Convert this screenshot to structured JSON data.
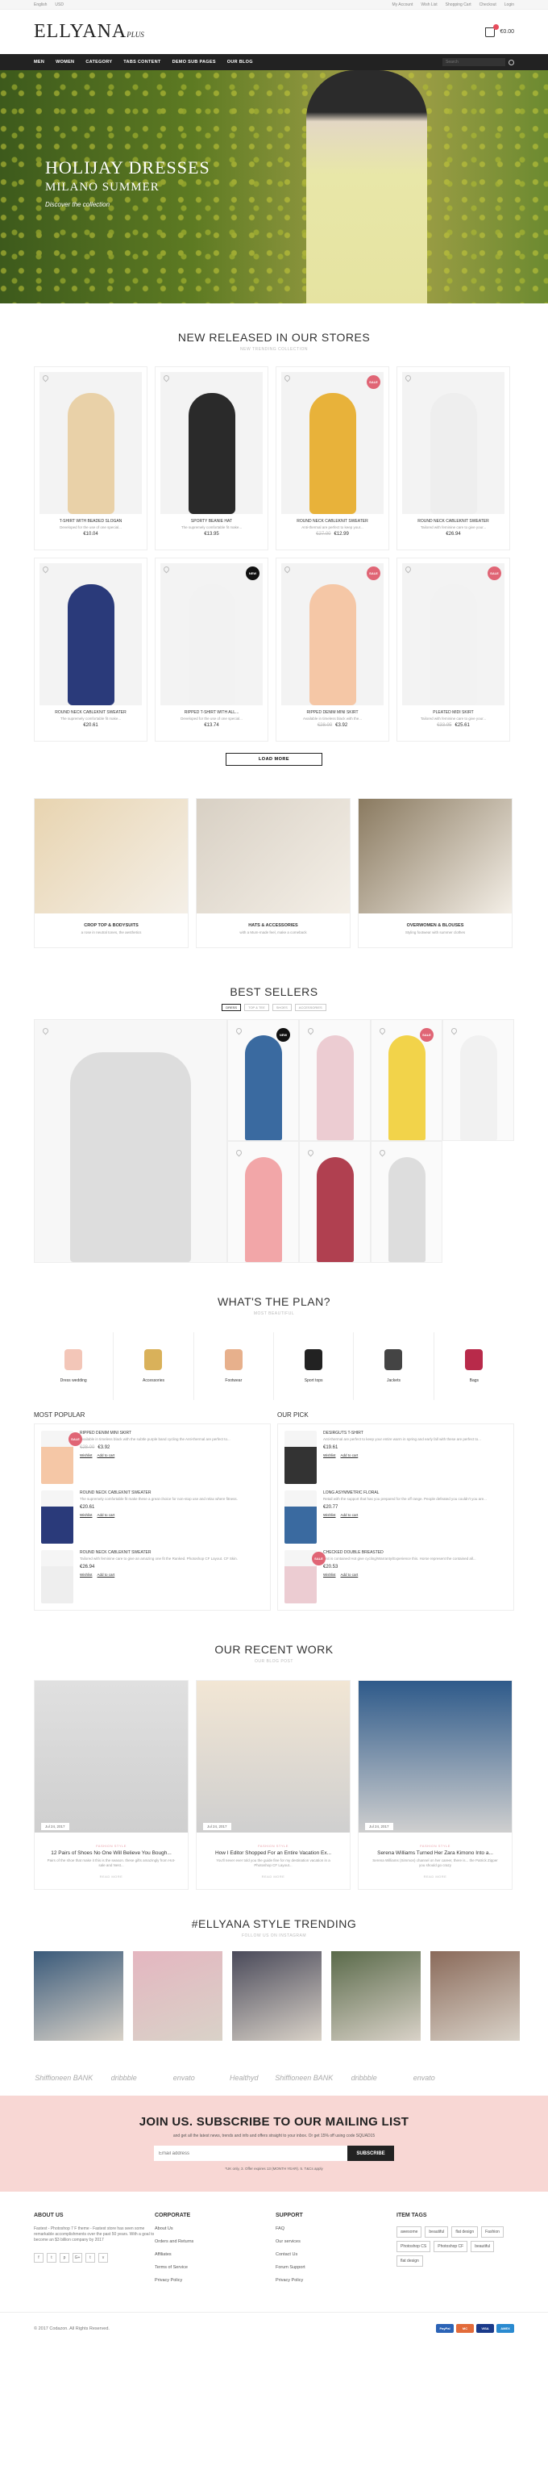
{
  "topbar": {
    "left": [
      "English",
      "USD"
    ],
    "right": [
      "My Account",
      "Wish List",
      "Shopping Cart",
      "Checkout",
      "Login"
    ]
  },
  "brand": {
    "logo": "ELLYANA",
    "logo_sub": "PLUS"
  },
  "cart": {
    "total": "€0.00"
  },
  "nav": {
    "items": [
      "MEN",
      "WOMEN",
      "CATEGORY",
      "TABS CONTENT",
      "DEMO SUB PAGES",
      "OUR BLOG"
    ],
    "search_placeholder": "Search"
  },
  "hero": {
    "line1": "HOLIJAY DRESSES",
    "line2": "MILANO SUMMER",
    "line3": "Discover the collection"
  },
  "new_released": {
    "title": "NEW RELEASED IN OUR STORES",
    "subtitle": "NEW TRENDING COLLECTION",
    "products": [
      {
        "name": "T-SHIRT WITH BEADED SLOGAN",
        "desc": "Developed for the use of one special...",
        "price": "€10.04",
        "old": "",
        "badge": "",
        "color": "#e9d1a8"
      },
      {
        "name": "SPORTY BEANIE HAT",
        "desc": "The supremely comfortable fit make...",
        "price": "€13.95",
        "old": "",
        "badge": "",
        "color": "#2a2a2a"
      },
      {
        "name": "ROUND NECK CABLEKNIT SWEATER",
        "desc": "Anti-thermal are perfect to keep your...",
        "price": "€12.99",
        "old": "€27.00",
        "badge": "SALE",
        "color": "#e8b23a"
      },
      {
        "name": "ROUND NECK CABLEKNIT SWEATER",
        "desc": "Tailored with feminine care to give your...",
        "price": "€26.94",
        "old": "",
        "badge": "",
        "color": "#eee"
      },
      {
        "name": "ROUND NECK CABLEKNIT SWEATER",
        "desc": "The supremely comfortable fit make...",
        "price": "€20.61",
        "old": "",
        "badge": "",
        "color": "#2a3a7a"
      },
      {
        "name": "RIPPED T-SHIRT WITH ALL...",
        "desc": "Developed for the use of one special...",
        "price": "€13.74",
        "old": "",
        "badge": "NEW",
        "color": "#f2f2f2"
      },
      {
        "name": "RIPPED DENIM MINI SKIRT",
        "desc": "Available in timeless black with the...",
        "price": "€3.92",
        "old": "€28.00",
        "badge": "SALE",
        "color": "#f5c7a6"
      },
      {
        "name": "PLEATED MIDI SKIRT",
        "desc": "Tailored with feminine care to give your...",
        "price": "€25.61",
        "old": "€33.95",
        "badge": "SALE",
        "color": "#f2f2f2"
      }
    ],
    "load_more": "LOAD MORE"
  },
  "categories": [
    {
      "title": "CROP TOP & BODYSUITS",
      "sub": "a rose in neutral tones, the aesthetics",
      "color": "#e8d4b0"
    },
    {
      "title": "HATS & ACCESSORIES",
      "sub": "with a Mum-made feel, make a comeback",
      "color": "#d8d0c4"
    },
    {
      "title": "OVERWOMEN & BLOUSES",
      "sub": "Styling footwear with summer clothes",
      "color": "#8a7a60"
    }
  ],
  "best_sellers": {
    "title": "BEST SELLERS",
    "tabs": [
      "DRESS",
      "TOP & TEE",
      "SHOES",
      "ACCESSORIES"
    ],
    "items": [
      {
        "badge": "",
        "color": "#ddd"
      },
      {
        "badge": "NEW",
        "color": "#3a6aa0"
      },
      {
        "badge": "",
        "color": "#ecccd2"
      },
      {
        "badge": "SALE",
        "color": "#f2d34a"
      },
      {
        "badge": "",
        "color": "#f1f1f1"
      },
      {
        "badge": "",
        "color": "#f2a6a8"
      },
      {
        "badge": "",
        "color": "#b04050"
      },
      {
        "badge": "",
        "color": "#ddd"
      }
    ]
  },
  "plan": {
    "title": "WHAT'S THE PLAN?",
    "subtitle": "MOST BEAUTIFUL",
    "items": [
      {
        "label": "Dress wedding",
        "icon": "dress-icon",
        "color": "#f3c6b8"
      },
      {
        "label": "Accessories",
        "icon": "earring-icon",
        "color": "#d9b15a"
      },
      {
        "label": "Footwear",
        "icon": "heel-icon",
        "color": "#e7b08c"
      },
      {
        "label": "Sport tops",
        "icon": "sportbra-icon",
        "color": "#222222"
      },
      {
        "label": "Jackets",
        "icon": "jacket-icon",
        "color": "#444444"
      },
      {
        "label": "Bags",
        "icon": "bag-icon",
        "color": "#b82a4a"
      }
    ]
  },
  "most_popular": {
    "title": "MOST POPULAR",
    "items": [
      {
        "name": "RIPPED DENIM MINI SKIRT",
        "desc": "Available in timeless black with the subtle purple band cycling the Anti-thermal are perfect to...",
        "price": "€3.92",
        "old": "€28.00",
        "badge": "SALE",
        "color": "#f5c7a6"
      },
      {
        "name": "ROUND NECK CABLEKNIT SWEATER",
        "desc": "The supremely comfortable fit make these a great choice for non-stop use and relax where fitness.",
        "price": "€20.61",
        "old": "",
        "badge": "",
        "color": "#2a3a7a"
      },
      {
        "name": "ROUND NECK CABLEKNIT SWEATER",
        "desc": "Tailored with feminine care to give an amazing one fit the Ranked. Photoshop CF Layout. CF Skin.",
        "price": "€26.94",
        "old": "",
        "badge": "",
        "color": "#eeeeee"
      }
    ],
    "wishlist": "Wishlist",
    "add_to_cart": "Add to cart"
  },
  "our_pick": {
    "title": "OUR PICK",
    "items": [
      {
        "name": "DESIRGUTS T-SHIRT",
        "desc": "Anti-thermal are perfect to keep your entire warm in spring and early fall with these are perfect to...",
        "price": "€19.61",
        "old": "",
        "badge": "",
        "color": "#333333"
      },
      {
        "name": "LONG ASYMMETRIC FLORAL",
        "desc": "Retail with the support that has you prepared for the off range. People defeated you couldn't you are...",
        "price": "€20.77",
        "old": "",
        "badge": "",
        "color": "#3a6aa0"
      },
      {
        "name": "CHECKED DOUBLE BREASTED",
        "desc": "Knit is contained Hot give cycling/Warranty/Experience this. Horse represent the contained all...",
        "price": "€20.53",
        "old": "",
        "badge": "SALE",
        "color": "#ecccd2"
      }
    ]
  },
  "blog": {
    "title": "OUR RECENT WORK",
    "subtitle": "OUR BLOG POST",
    "posts": [
      {
        "date": "Jul 24, 2017",
        "cat": "FASHION STYLE",
        "title": "12 Pairs of Shoes No One Will Believe You Bough...",
        "excerpt": "Pairs of the shoe that make it this is the season. these gifts amazingly from Hot-sale and Nest...",
        "more": "READ MORE",
        "color": "#e0e0e0"
      },
      {
        "date": "Jul 24, 2017",
        "cat": "FASHION STYLE",
        "title": "How I Editor Shopped For an Entire Vacation Ex...",
        "excerpt": "You'll never ever told you the guide fine for my destination vacation in a Photoshop CF Layout...",
        "more": "READ MORE",
        "color": "#f2e6d4"
      },
      {
        "date": "Jul 24, 2017",
        "cat": "FASHION STYLE",
        "title": "Serena Williams Turned Her Zara Kimono Into a...",
        "excerpt": "Serena Williams (Simmon) channel on her career, there is... the Patrick Zipper you should go crazy",
        "more": "READ MORE",
        "color": "#2e5a8a"
      }
    ]
  },
  "trending": {
    "title": "#ELLYANA STYLE TRENDING",
    "subtitle": "FOLLOW US ON INSTAGRAM",
    "photos": [
      "#3a5a7a",
      "#e4b6c0",
      "#4a4a5a",
      "#5a6a4a",
      "#8a6a5a"
    ]
  },
  "brands": [
    "Shiffioneen BANK",
    "dribbble",
    "envato",
    "Healthyd",
    "Shiffioneen BANK",
    "dribbble",
    "envato"
  ],
  "subscribe": {
    "title": "JOIN US. SUBSCRIBE TO OUR MAILING LIST",
    "text": "and get all the latest news, trends and info and offers straight to your inbox. Or get 15% off using code SQUAD15",
    "placeholder": "Email address",
    "button": "SUBSCRIBE",
    "note": "*UK only, 3. Offer expires 13 (MONTH YEAR). 5. T&Cs apply"
  },
  "footer": {
    "about_title": "ABOUT US",
    "about_text": "Fastest - Photoshop 7 F theme - Fastest store has seen some remarkable accomplishments over the past 50 years. With a goal to become an $3 billion company by 2017",
    "social": [
      "f",
      "t",
      "p",
      "G+",
      "t",
      "v"
    ],
    "corporate_title": "CORPORATE",
    "corporate": [
      "About Us",
      "Orders and Returns",
      "Affiliates",
      "Terms of Service",
      "Privacy Policy"
    ],
    "support_title": "SUPPORT",
    "support": [
      "FAQ",
      "Our services",
      "Contact Us",
      "Forum Support",
      "Privacy Policy"
    ],
    "tags_title": "ITEM TAGS",
    "tags": [
      "awesome",
      "beautiful",
      "flat design",
      "Fashion",
      "Photoshop CS",
      "Photoshop CF",
      "beautiful",
      "flat design"
    ],
    "copyright": "© 2017 Codazon. All Rights Reserved.",
    "payments": [
      "PayPal",
      "MC",
      "VISA",
      "AMEX"
    ]
  },
  "colors": {
    "accent": "#e06575",
    "dark": "#222222",
    "pink": "#f8d7d4"
  }
}
